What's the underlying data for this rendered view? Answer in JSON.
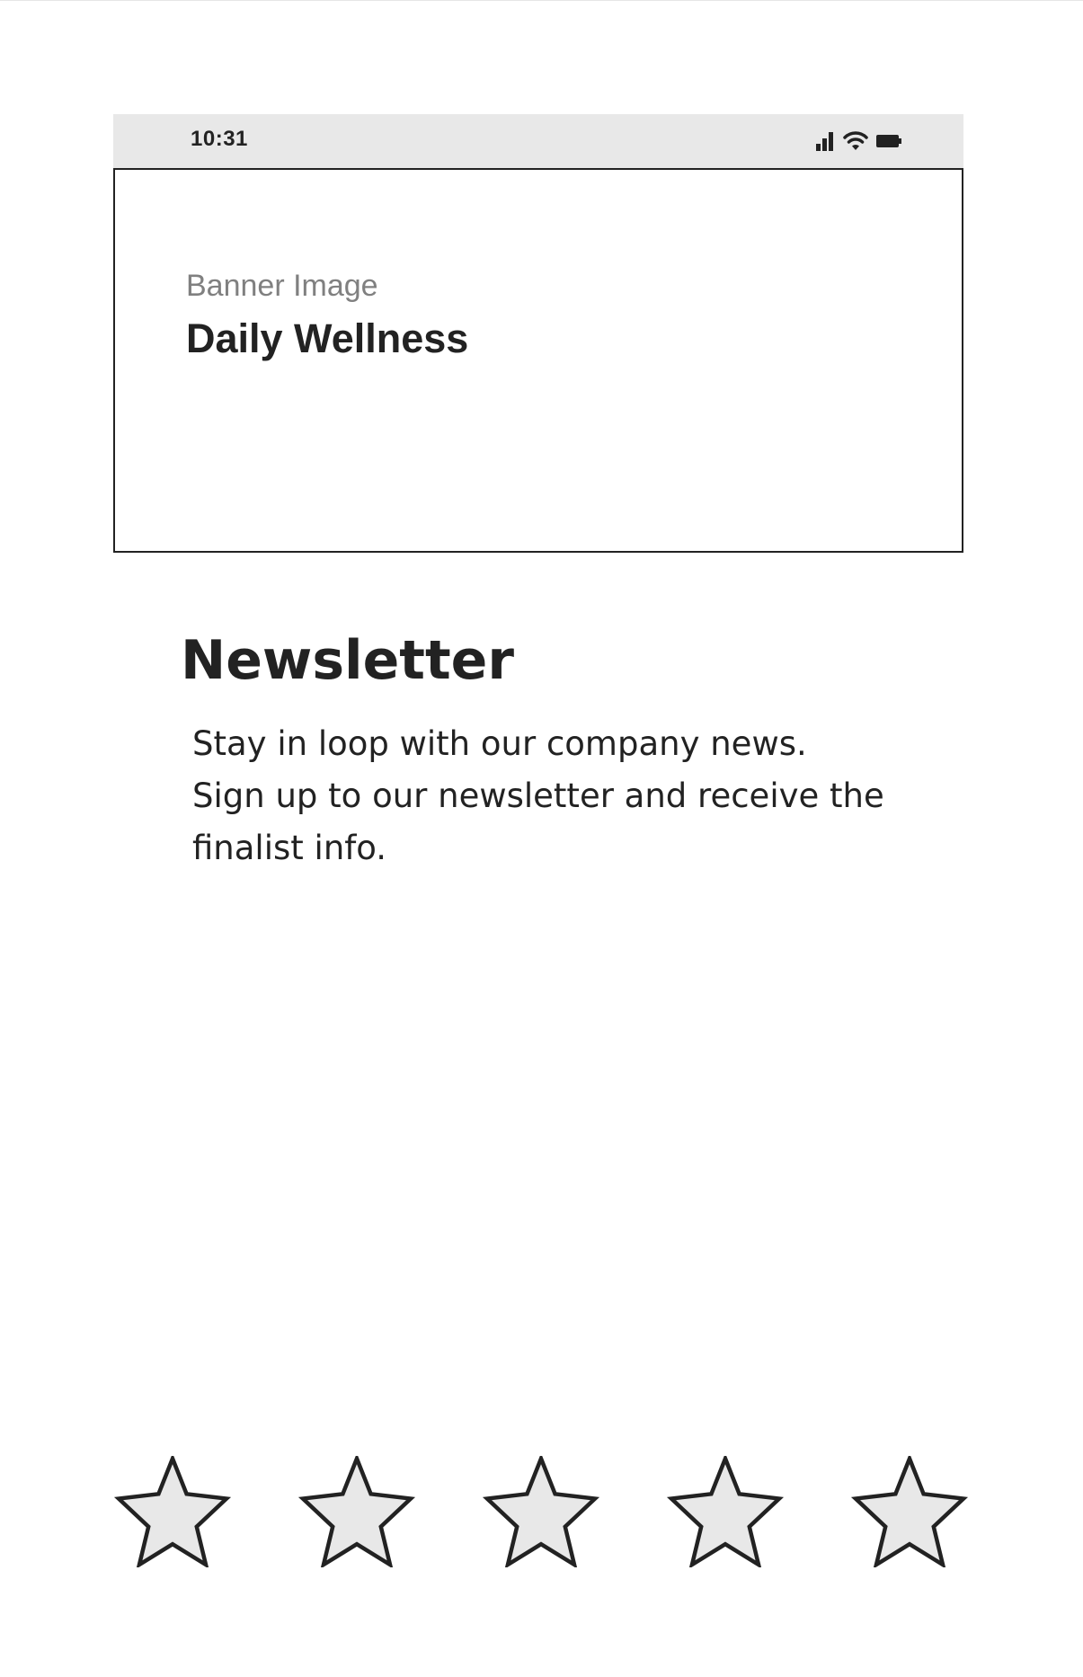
{
  "status_bar": {
    "time": "10:31",
    "icons": [
      "signal-icon",
      "wifi-icon",
      "battery-icon"
    ]
  },
  "banner": {
    "label": "Banner Image",
    "title": "Daily Wellness"
  },
  "newsletter": {
    "title": "Newsletter",
    "lines": [
      "Stay in loop with our company news.",
      "Sign up to our newsletter and receive the",
      "finalist info."
    ]
  },
  "rating": {
    "icon": "star-icon",
    "max": 5,
    "value": 0
  },
  "colors": {
    "status_bar_bg": "#e8e8e8",
    "text": "#222222",
    "muted_text": "#808080",
    "star_fill": "#e8e8e8",
    "star_stroke": "#222222"
  }
}
